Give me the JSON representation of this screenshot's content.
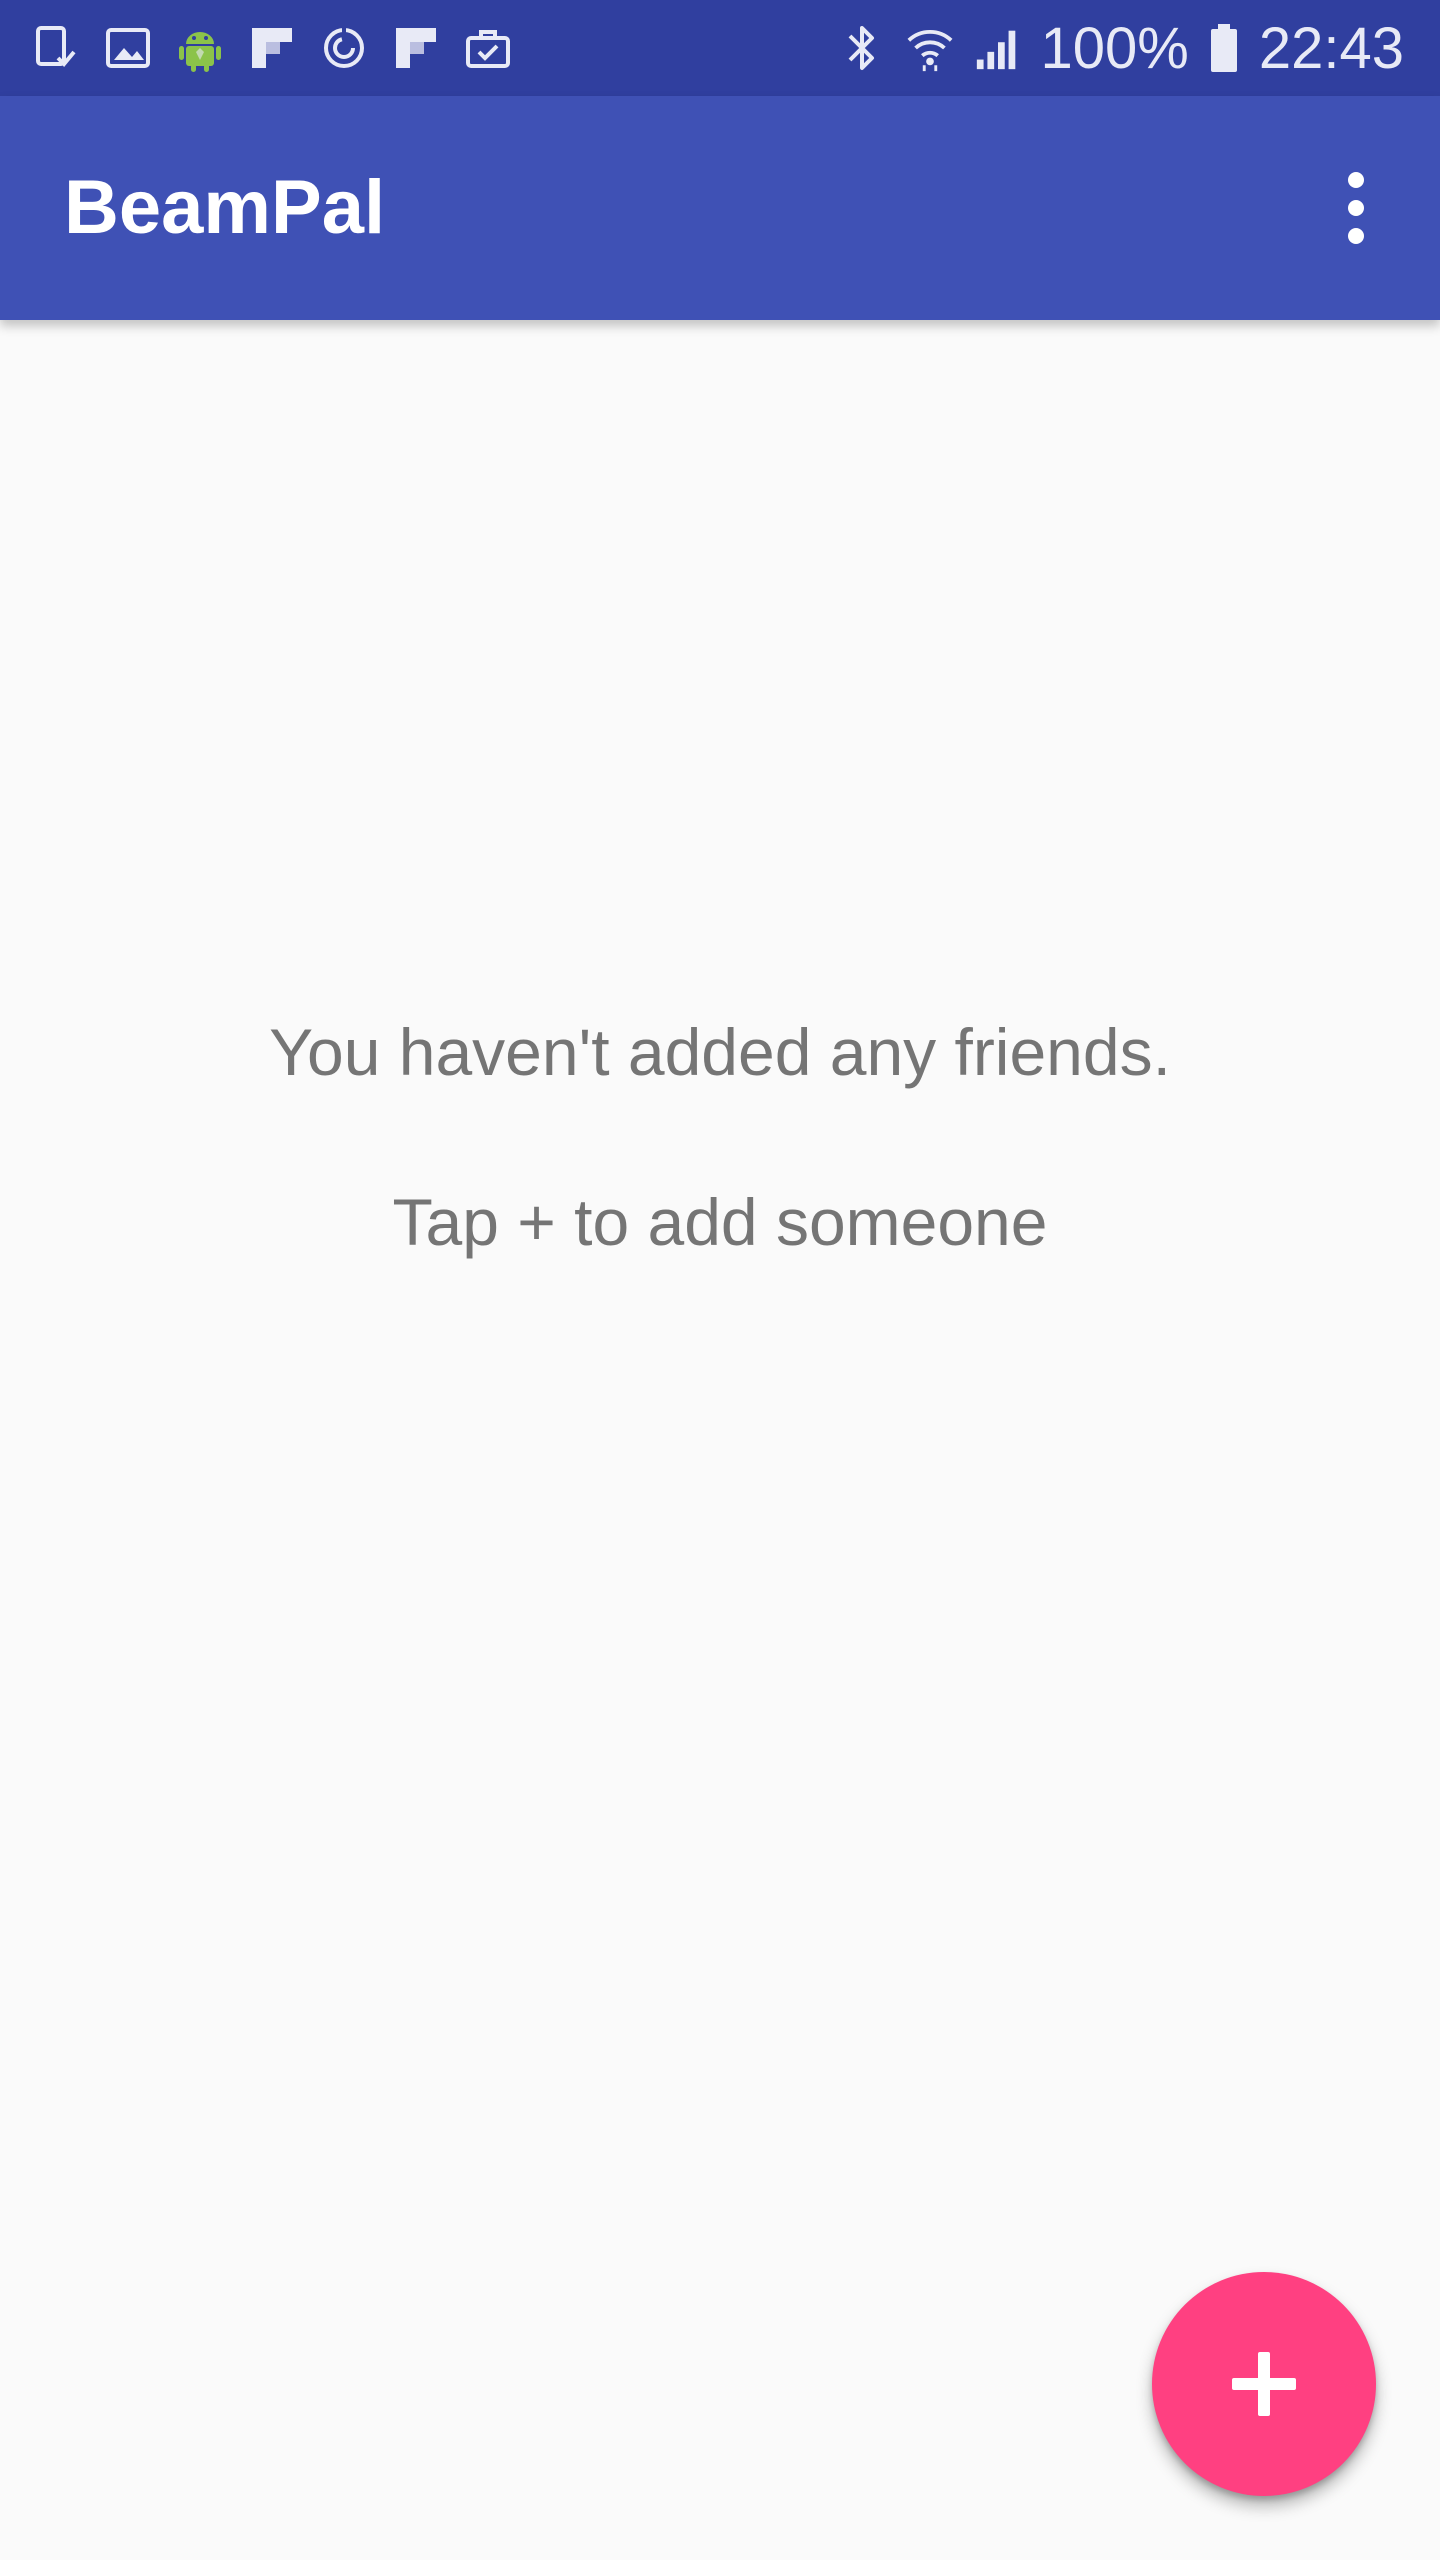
{
  "colors": {
    "status_bar": "#303F9F",
    "app_bar": "#3F51B5",
    "background": "#FAFAFA",
    "accent": "#FF4081",
    "empty_text": "#757575"
  },
  "status_bar": {
    "left_icons": [
      "sim-download-icon",
      "image-icon",
      "android-icon",
      "flipboard-icon",
      "sync-icon",
      "flipboard-icon",
      "briefcase-icon"
    ],
    "right_icons": [
      "bluetooth-icon",
      "wifi-icon",
      "signal-icon"
    ],
    "battery_percent": "100%",
    "battery_icon": "battery-full-icon",
    "time": "22:43"
  },
  "app_bar": {
    "title": "BeamPal",
    "menu_icon": "more-vert-icon"
  },
  "empty_state": {
    "line1": "You haven't added any friends.",
    "line2": "Tap + to add someone"
  },
  "fab": {
    "icon": "plus-icon"
  }
}
